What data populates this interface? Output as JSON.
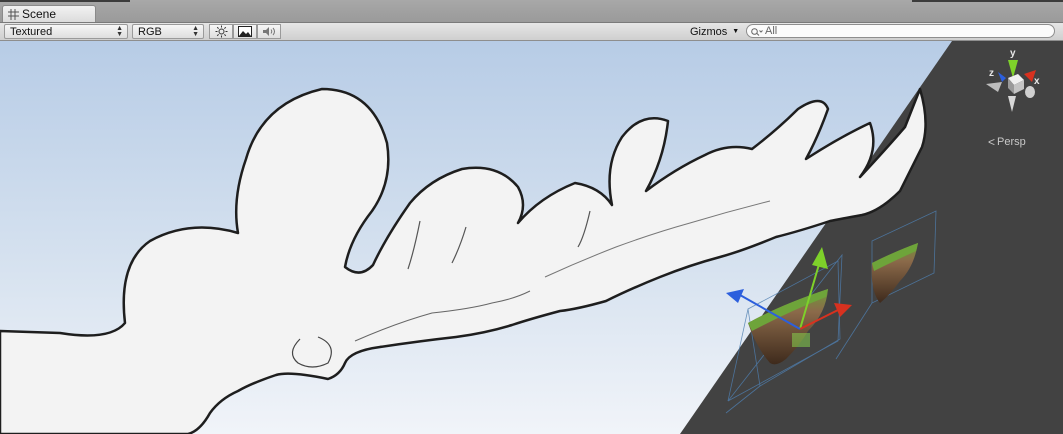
{
  "window": {
    "tab": {
      "icon": "grid-icon",
      "label": "Scene"
    }
  },
  "toolbar": {
    "draw_mode": "Textured",
    "render_mode": "RGB",
    "toggles": [
      "sun-icon",
      "image-icon",
      "speaker-icon"
    ],
    "gizmos_label": "Gizmos",
    "search": {
      "placeholder": "All",
      "value": ""
    }
  },
  "scene_view": {
    "projection_label": "Persp",
    "axis_labels": {
      "x": "x",
      "y": "y",
      "z": "z"
    },
    "colors": {
      "sky_top": "#b9cde6",
      "sky_bottom": "#eef2f8",
      "cloud_fill": "#f3f3f3",
      "cloud_outline": "#1e1e1e",
      "background": "#424242",
      "axis_x": "#d8311f",
      "axis_y": "#7ed12a",
      "axis_z": "#2c5fdd"
    }
  }
}
